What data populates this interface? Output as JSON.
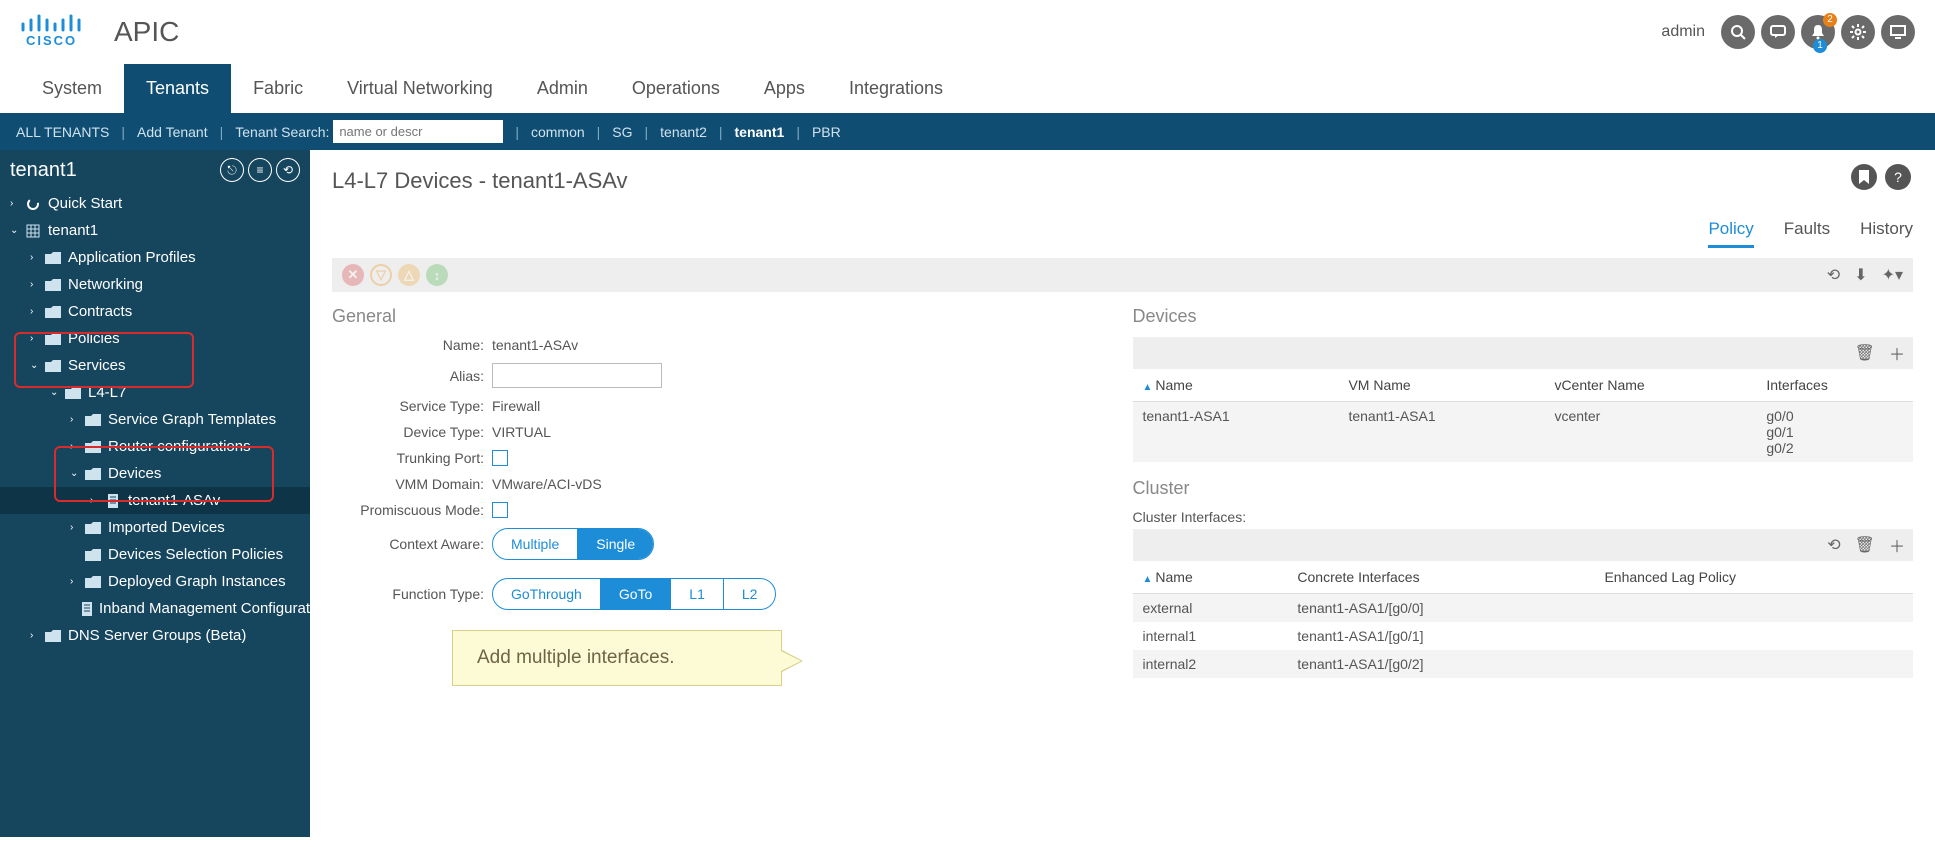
{
  "header": {
    "app_title": "APIC",
    "user": "admin",
    "alert_badge_top": "2",
    "alert_badge_bottom": "1"
  },
  "main_nav": [
    "System",
    "Tenants",
    "Fabric",
    "Virtual Networking",
    "Admin",
    "Operations",
    "Apps",
    "Integrations"
  ],
  "sub_nav": {
    "all": "ALL TENANTS",
    "add": "Add Tenant",
    "search_label": "Tenant Search:",
    "search_placeholder": "name or descr",
    "items": [
      "common",
      "SG",
      "tenant2",
      "tenant1",
      "PBR"
    ]
  },
  "tree": {
    "root_title": "tenant1",
    "quick_start": "Quick Start",
    "tenant": "tenant1",
    "app_profiles": "Application Profiles",
    "networking": "Networking",
    "contracts": "Contracts",
    "policies": "Policies",
    "services": "Services",
    "l4l7": "L4-L7",
    "sg_templates": "Service Graph Templates",
    "router_cfg": "Router configurations",
    "devices": "Devices",
    "tenant_asav": "tenant1-ASAv",
    "imported": "Imported Devices",
    "dev_sel": "Devices Selection Policies",
    "deployed": "Deployed Graph Instances",
    "inband": "Inband Management Configurat",
    "dns": "DNS Server Groups (Beta)"
  },
  "content": {
    "title": "L4-L7 Devices - tenant1-ASAv",
    "tabs": [
      "Policy",
      "Faults",
      "History"
    ],
    "general": {
      "title": "General",
      "name_lbl": "Name:",
      "name_val": "tenant1-ASAv",
      "alias_lbl": "Alias:",
      "service_type_lbl": "Service Type:",
      "service_type_val": "Firewall",
      "device_type_lbl": "Device Type:",
      "device_type_val": "VIRTUAL",
      "trunking_lbl": "Trunking Port:",
      "vmm_lbl": "VMM Domain:",
      "vmm_val": "VMware/ACI-vDS",
      "promiscuous_lbl": "Promiscuous Mode:",
      "context_lbl": "Context Aware:",
      "context_options": [
        "Multiple",
        "Single"
      ],
      "function_lbl": "Function Type:",
      "function_options": [
        "GoThrough",
        "GoTo",
        "L1",
        "L2"
      ]
    },
    "callout": "Add multiple interfaces.",
    "devices": {
      "title": "Devices",
      "columns": [
        "Name",
        "VM Name",
        "vCenter Name",
        "Interfaces"
      ],
      "rows": [
        {
          "name": "tenant1-ASA1",
          "vm": "tenant1-ASA1",
          "vc": "vcenter",
          "ifaces": [
            "g0/0",
            "g0/1",
            "g0/2"
          ]
        }
      ]
    },
    "cluster": {
      "title": "Cluster",
      "sub": "Cluster Interfaces:",
      "columns": [
        "Name",
        "Concrete Interfaces",
        "Enhanced Lag Policy"
      ],
      "rows": [
        {
          "name": "external",
          "ci": "tenant1-ASA1/[g0/0]",
          "lag": ""
        },
        {
          "name": "internal1",
          "ci": "tenant1-ASA1/[g0/1]",
          "lag": ""
        },
        {
          "name": "internal2",
          "ci": "tenant1-ASA1/[g0/2]",
          "lag": ""
        }
      ]
    }
  }
}
